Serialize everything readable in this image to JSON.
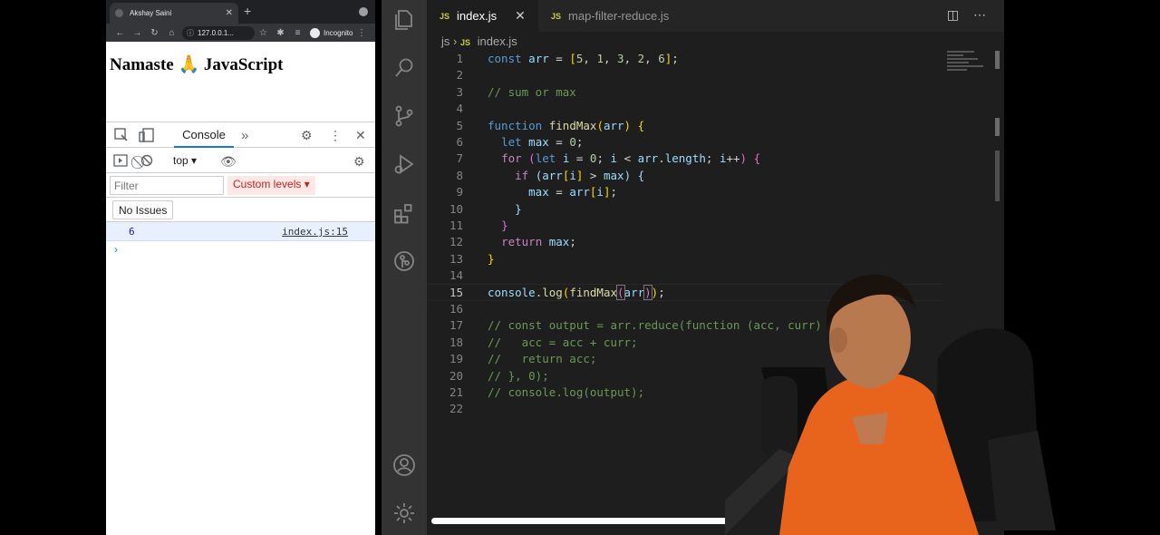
{
  "browser": {
    "tab_title": "Akshay Saini",
    "url": "127.0.0.1...",
    "incognito_label": "Incognito",
    "page_heading": "Namaste 🙏 JavaScript",
    "devtools": {
      "active_tab": "Console",
      "context": "top",
      "filter_placeholder": "Filter",
      "levels_label": "Custom levels",
      "issues_label": "No Issues",
      "log_value": "6",
      "log_source": "index.js:15",
      "prompt": "›"
    }
  },
  "editor": {
    "tabs": [
      {
        "badge": "JS",
        "label": "index.js",
        "active": true
      },
      {
        "badge": "JS",
        "label": "map-filter-reduce.js",
        "active": false
      }
    ],
    "breadcrumb": {
      "folder": "js",
      "badge": "JS",
      "file": "index.js"
    },
    "current_line": 15,
    "lines": [
      {
        "n": "1"
      },
      {
        "n": "2"
      },
      {
        "n": "3"
      },
      {
        "n": "4"
      },
      {
        "n": "5"
      },
      {
        "n": "6"
      },
      {
        "n": "7"
      },
      {
        "n": "8"
      },
      {
        "n": "9"
      },
      {
        "n": "10"
      },
      {
        "n": "11"
      },
      {
        "n": "12"
      },
      {
        "n": "13"
      },
      {
        "n": "14"
      },
      {
        "n": "15"
      },
      {
        "n": "16"
      },
      {
        "n": "17"
      },
      {
        "n": "18"
      },
      {
        "n": "19"
      },
      {
        "n": "20"
      },
      {
        "n": "21"
      },
      {
        "n": "22"
      }
    ],
    "code": {
      "l1": [
        "const",
        "arr",
        "5",
        "1",
        "3",
        "2",
        "6"
      ],
      "l3": "// sum or max",
      "l5": [
        "function",
        "findMax",
        "arr"
      ],
      "l6": [
        "let",
        "max",
        "0"
      ],
      "l7": [
        "for",
        "let",
        "i",
        "0",
        "i",
        "arr",
        "length",
        "i"
      ],
      "l8": [
        "if",
        "arr",
        "i",
        "max"
      ],
      "l9": [
        "max",
        "arr",
        "i"
      ],
      "l12": [
        "return",
        "max"
      ],
      "l15": [
        "console",
        "log",
        "findMax",
        "arr"
      ],
      "l17": "// const output = arr.reduce(function (acc, curr)",
      "l18": "//   acc = acc + curr;",
      "l19": "//   return acc;",
      "l20": "// }, 0);",
      "l21": "// console.log(output);"
    }
  },
  "colors": {
    "editor_bg": "#1e1e1e",
    "activity_bar": "#333333",
    "accent_blue": "#1a73e8",
    "js_badge": "#cbcb41"
  },
  "icons": [
    "explorer-icon",
    "search-icon",
    "source-control-icon",
    "run-debug-icon",
    "extensions-icon",
    "git-graph-icon",
    "account-icon",
    "settings-gear-icon"
  ]
}
